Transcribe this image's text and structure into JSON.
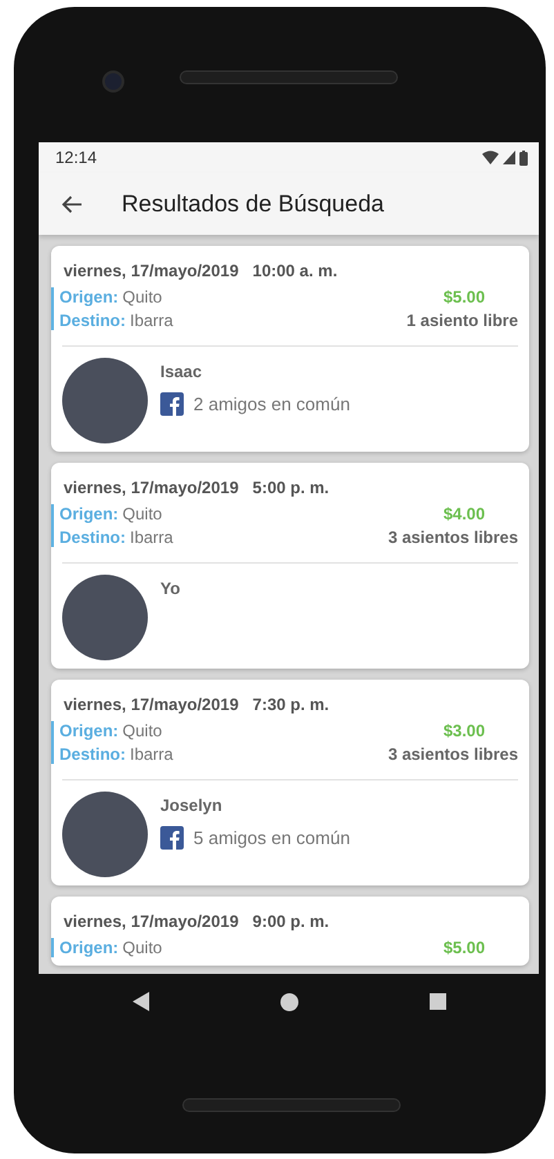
{
  "status_bar": {
    "time": "12:14"
  },
  "app_bar": {
    "title": "Resultados de Búsqueda"
  },
  "trips": [
    {
      "date": "viernes, 17/mayo/2019",
      "time": "10:00 a. m.",
      "origin_label": "Origen:",
      "origin": "Quito",
      "destination_label": "Destino:",
      "destination": "Ibarra",
      "price": "$5.00",
      "seats": "1 asiento libre",
      "driver": {
        "name": "Isaac",
        "mutual_friends": "2 amigos en común"
      }
    },
    {
      "date": "viernes, 17/mayo/2019",
      "time": "5:00 p. m.",
      "origin_label": "Origen:",
      "origin": "Quito",
      "destination_label": "Destino:",
      "destination": "Ibarra",
      "price": "$4.00",
      "seats": "3 asientos libres",
      "driver": {
        "name": "Yo"
      }
    },
    {
      "date": "viernes, 17/mayo/2019",
      "time": "7:30 p. m.",
      "origin_label": "Origen:",
      "origin": "Quito",
      "destination_label": "Destino:",
      "destination": "Ibarra",
      "price": "$3.00",
      "seats": "3 asientos libres",
      "driver": {
        "name": "Joselyn",
        "mutual_friends": "5 amigos en común"
      }
    },
    {
      "date": "viernes, 17/mayo/2019",
      "time": "9:00 p. m.",
      "origin_label": "Origen:",
      "origin": "Quito",
      "price": "$5.00"
    }
  ]
}
